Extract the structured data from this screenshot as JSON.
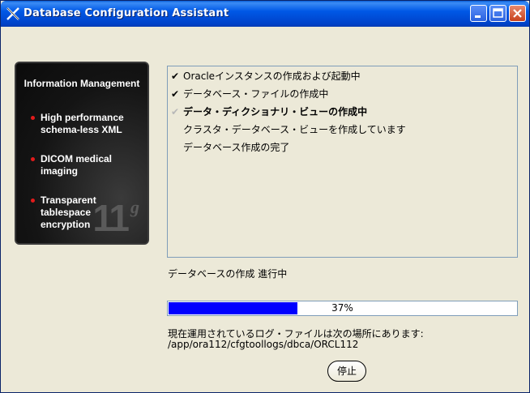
{
  "window": {
    "title": "Database Configuration Assistant"
  },
  "side_panel": {
    "title": "Information Management",
    "features": [
      "High performance schema-less XML",
      "DICOM medical imaging",
      "Transparent tablespace encryption"
    ],
    "version_mark": "11",
    "version_suffix": "g",
    "bullet_color": "#e21b1b"
  },
  "steps": [
    {
      "mark": "✔",
      "label": "Oracleインスタンスの作成および起動中",
      "state": "done"
    },
    {
      "mark": "✔",
      "label": "データベース・ファイルの作成中",
      "state": "done"
    },
    {
      "mark": "✔",
      "label": "データ・ディクショナリ・ビューの作成中",
      "state": "current"
    },
    {
      "mark": "",
      "label": "クラスタ・データベース・ビューを作成しています",
      "state": "pending"
    },
    {
      "mark": "",
      "label": "データベース作成の完了",
      "state": "pending"
    }
  ],
  "status": {
    "label": "データベースの作成 進行中",
    "progress_percent": 37,
    "progress_text": "37%",
    "progress_color": "#0000ff"
  },
  "log": {
    "label": "現在運用されているログ・ファイルは次の場所にあります:",
    "path": "/app/ora112/cfgtoollogs/dbca/ORCL112"
  },
  "buttons": {
    "stop": "停止"
  },
  "icons": {
    "app": "x-app-icon",
    "minimize": "minimize-icon",
    "maximize": "maximize-icon",
    "close": "close-icon"
  }
}
